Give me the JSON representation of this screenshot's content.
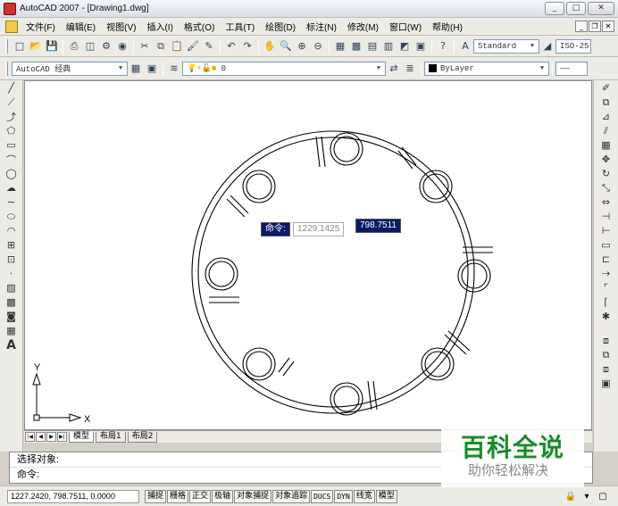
{
  "window": {
    "title": "AutoCAD 2007 - [Drawing1.dwg]",
    "minimize": "_",
    "maximize": "□",
    "close": "✕"
  },
  "menu": [
    "文件(F)",
    "编辑(E)",
    "视图(V)",
    "插入(I)",
    "格式(O)",
    "工具(T)",
    "绘图(D)",
    "标注(N)",
    "修改(M)",
    "窗口(W)",
    "帮助(H)"
  ],
  "toolbar": {
    "text_style": "Standard",
    "dim_style": "ISO-25",
    "workspace": "AutoCAD 经典",
    "layer": "0",
    "color": "ByLayer"
  },
  "canvas": {
    "command_tip": "命令:",
    "input_value": "1229.1425",
    "y_value": "798.7511",
    "ucs_x": "X",
    "ucs_y": "Y"
  },
  "tabs": {
    "nav": [
      "|◀",
      "◀",
      "▶",
      "▶|"
    ],
    "model": "模型",
    "layout1": "布局1",
    "layout2": "布局2"
  },
  "command": {
    "line1": "选择对象:",
    "line2": "命令:"
  },
  "status": {
    "coords": "1227.2420,  798.7511, 0.0000",
    "buttons": [
      "捕捉",
      "栅格",
      "正交",
      "极轴",
      "对象捕捉",
      "对象追踪",
      "DUCS",
      "DYN",
      "线宽",
      "模型"
    ]
  },
  "watermark": {
    "brand": "百科全说",
    "slogan": "助你轻松解决"
  },
  "colors": {
    "canvas": "#ffffff",
    "tooltip": "#0a1a66",
    "watermark": "#1a8c2c"
  }
}
